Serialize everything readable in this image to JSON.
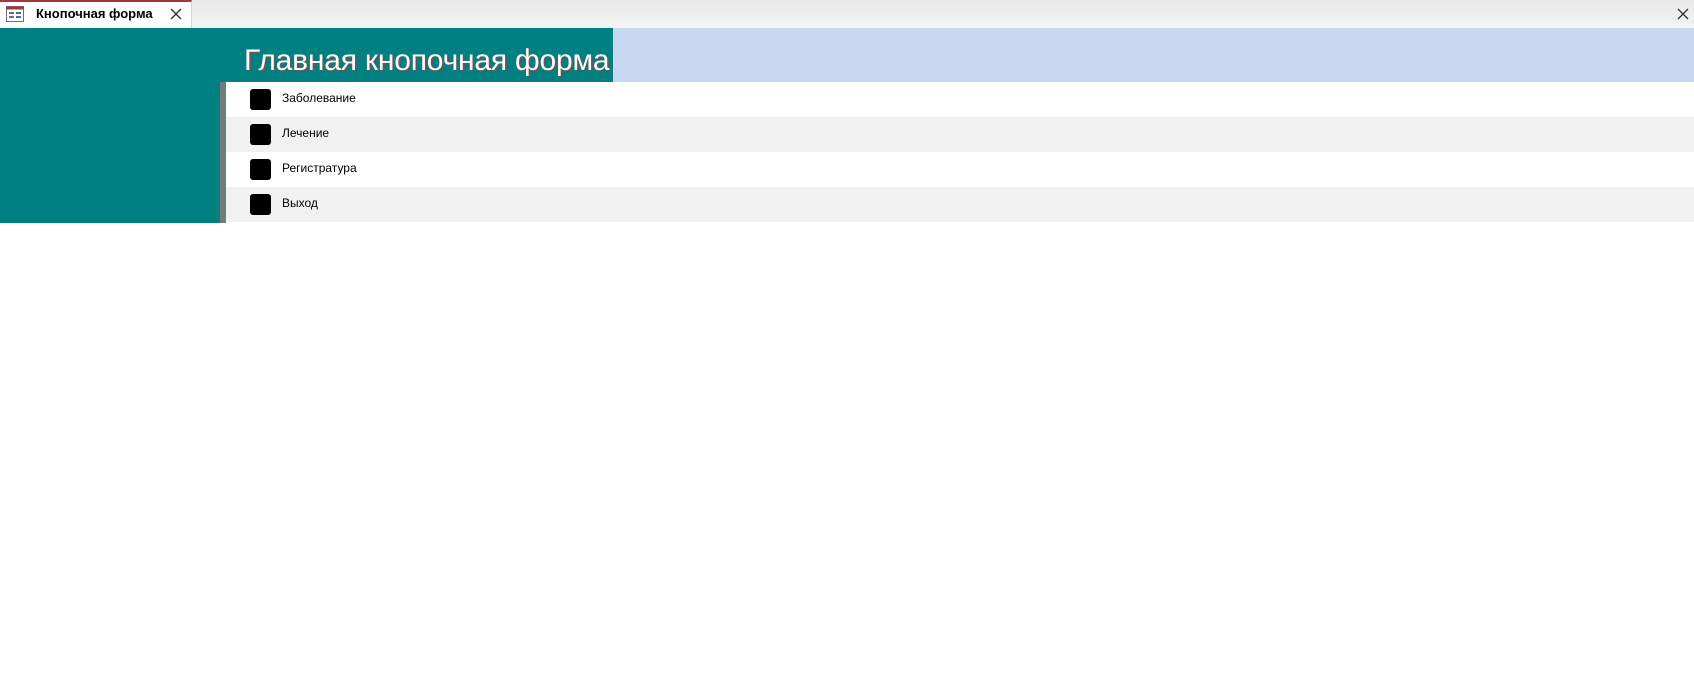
{
  "tab": {
    "title": "Кнопочная форма",
    "icon": "form-icon",
    "accent_color": "#a4373a"
  },
  "form": {
    "title": "Главная кнопочная форма",
    "header_color": "#008080",
    "strip_color": "#c7d9f0",
    "items": [
      {
        "label": "Заболевание"
      },
      {
        "label": "Лечение"
      },
      {
        "label": "Регистратура"
      },
      {
        "label": "Выход"
      }
    ]
  }
}
